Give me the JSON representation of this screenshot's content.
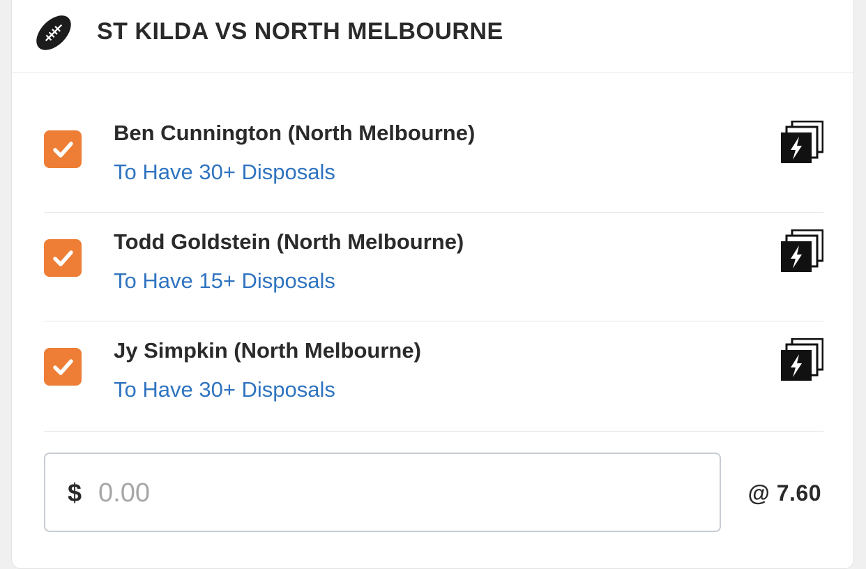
{
  "header": {
    "icon": "football-icon",
    "title": "ST KILDA VS NORTH MELBOURNE"
  },
  "selections": [
    {
      "player": "Ben Cunnington (North Melbourne)",
      "market": "To Have 30+ Disposals",
      "checked": true
    },
    {
      "player": "Todd Goldstein (North Melbourne)",
      "market": "To Have 15+ Disposals",
      "checked": true
    },
    {
      "player": "Jy Simpkin (North Melbourne)",
      "market": "To Have 30+ Disposals",
      "checked": true
    }
  ],
  "stake": {
    "currency": "$",
    "placeholder": "0.00",
    "value": ""
  },
  "odds": "@ 7.60",
  "colors": {
    "accent": "#ee7e35",
    "link": "#2f74c0",
    "text": "#2a2a2a"
  }
}
